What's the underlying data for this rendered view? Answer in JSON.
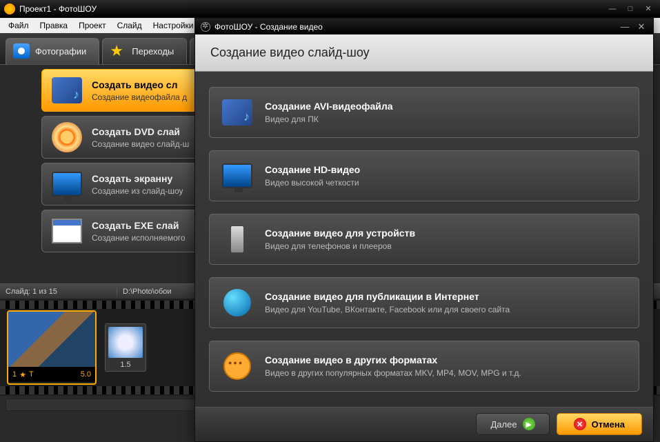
{
  "main_window": {
    "title": "Проект1 - ФотоШОУ",
    "menubar": [
      "Файл",
      "Правка",
      "Проект",
      "Слайд",
      "Настройки"
    ],
    "tabs": [
      {
        "label": "Фотографии",
        "icon": "camera"
      },
      {
        "label": "Переходы",
        "icon": "star"
      }
    ],
    "options": [
      {
        "title": "Создать видео сл",
        "desc": "Создание видеофайла д",
        "selected": true,
        "icon": "avi"
      },
      {
        "title": "Создать DVD слай",
        "desc": "Создание видео слайд-ш",
        "icon": "dvd"
      },
      {
        "title": "Создать экранну",
        "desc": "Создание из слайд-шоу",
        "icon": "monitor"
      },
      {
        "title": "Создать EXE слай",
        "desc": "Создание исполняемого",
        "icon": "window"
      }
    ],
    "timeline": {
      "slide_counter": "Слайд: 1 из 15",
      "path": "D:\\Photo\\обои",
      "slide_number": "1",
      "slide_duration": "5.0",
      "transition_duration": "1.5"
    }
  },
  "modal": {
    "titlebar": "ФотоШОУ - Создание видео",
    "header": "Создание видео слайд-шоу",
    "options": [
      {
        "title": "Создание AVI-видеофайла",
        "desc": "Видео для ПК",
        "icon": "avi"
      },
      {
        "title": "Создание HD-видео",
        "desc": "Видео высокой четкости",
        "icon": "monitor"
      },
      {
        "title": "Создание видео для устройств",
        "desc": "Видео для телефонов и плееров",
        "icon": "phone"
      },
      {
        "title": "Создание видео для публикации в Интернет",
        "desc": "Видео для YouTube, ВКонтакте, Facebook или для своего сайта",
        "icon": "globe"
      },
      {
        "title": "Создание видео в других форматах",
        "desc": "Видео в других популярных форматах MKV, MP4, MOV, MPG и т.д.",
        "icon": "reel"
      }
    ],
    "footer": {
      "next": "Далее",
      "cancel": "Отмена"
    }
  }
}
